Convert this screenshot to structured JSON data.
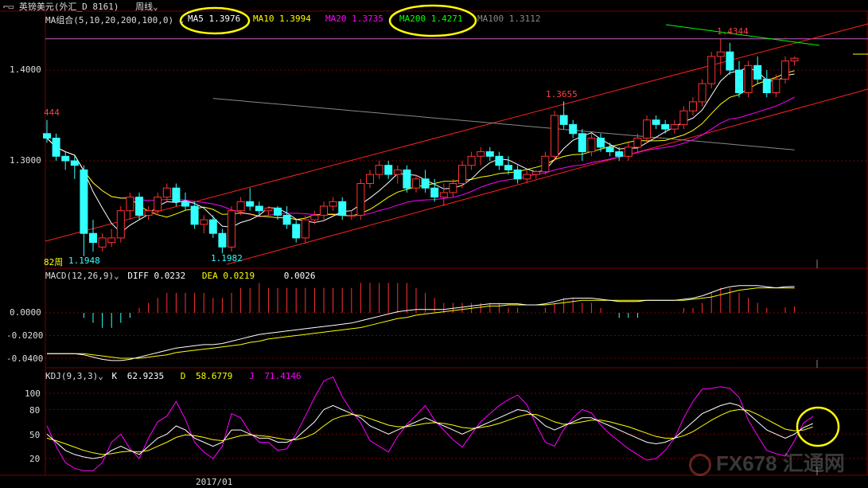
{
  "app": {
    "title_icon": "chart-icon",
    "instrument": "英镑美元(外汇_D 8161)",
    "period": "周线"
  },
  "colors": {
    "bg": "#000000",
    "grid": "#7a0000",
    "up": "#ff3232",
    "down": "#32ffff",
    "ma5": "#ffffff",
    "ma10": "#ffff00",
    "ma20": "#ff00ff",
    "ma100": "#888888",
    "ma200": "#00ff00",
    "channel": "#ff2020",
    "highlight": "#ffff00"
  },
  "main_panel": {
    "indicator_label": "MA组合(5,10,20,200,100,0)",
    "legend": [
      {
        "key": "ma5",
        "label": "MA5",
        "value": "1.3976",
        "color": "#ffffff"
      },
      {
        "key": "ma10",
        "label": "MA10",
        "value": "1.3994",
        "color": "#ffff00"
      },
      {
        "key": "ma20",
        "label": "MA20",
        "value": "1.3735",
        "color": "#ff00ff"
      },
      {
        "key": "ma200",
        "label": "MA200",
        "value": "1.4271",
        "color": "#00ff00"
      },
      {
        "key": "ma100",
        "label": "MA100",
        "value": "1.3112",
        "color": "#888888"
      }
    ],
    "y_ticks": [
      "1.4000",
      "1.3000"
    ],
    "annotations": {
      "high_right": "1.4344",
      "high_mid": "1.3655",
      "low_left": "1.1948",
      "low_mid": "1.1982",
      "left_cut": "444",
      "weeks": "82周"
    }
  },
  "macd_panel": {
    "label": "MACD(12,26,9)",
    "diff_label": "DIFF",
    "diff_value": "0.0232",
    "dea_label": "DEA",
    "dea_value": "0.0219",
    "macd_value": "0.0026",
    "y_ticks": [
      "0.0000",
      "-0.0200",
      "-0.0400"
    ]
  },
  "kdj_panel": {
    "label": "KDJ(9,3,3)",
    "k_label": "K",
    "k_value": "62.9235",
    "d_label": "D",
    "d_value": "58.6779",
    "j_label": "J",
    "j_value": "71.4146",
    "y_ticks": [
      "100",
      "80",
      "50",
      "20"
    ]
  },
  "x_axis": {
    "date_label": "2017/01"
  },
  "watermark": "FX678 汇通网",
  "chart_data": [
    {
      "type": "candlestick",
      "title": "英镑美元(外汇_D 8161) 周线",
      "y_ticks": [
        1.3,
        1.4
      ],
      "ylim": [
        1.17,
        1.445
      ],
      "weeks_shown": 82,
      "annotated_points": {
        "high": 1.4344,
        "mid_high": 1.3655,
        "low": 1.1948,
        "mid_low": 1.1982
      },
      "ohlc": [
        [
          1.33,
          1.345,
          1.32,
          1.325
        ],
        [
          1.325,
          1.33,
          1.3,
          1.305
        ],
        [
          1.305,
          1.31,
          1.29,
          1.3
        ],
        [
          1.3,
          1.305,
          1.28,
          1.295
        ],
        [
          1.29,
          1.295,
          1.195,
          1.22
        ],
        [
          1.22,
          1.235,
          1.2,
          1.21
        ],
        [
          1.205,
          1.22,
          1.2,
          1.215
        ],
        [
          1.21,
          1.225,
          1.205,
          1.215
        ],
        [
          1.215,
          1.25,
          1.21,
          1.245
        ],
        [
          1.245,
          1.265,
          1.235,
          1.26
        ],
        [
          1.26,
          1.265,
          1.235,
          1.24
        ],
        [
          1.24,
          1.25,
          1.235,
          1.245
        ],
        [
          1.245,
          1.265,
          1.24,
          1.26
        ],
        [
          1.26,
          1.275,
          1.255,
          1.27
        ],
        [
          1.27,
          1.275,
          1.25,
          1.255
        ],
        [
          1.255,
          1.265,
          1.245,
          1.25
        ],
        [
          1.25,
          1.255,
          1.225,
          1.23
        ],
        [
          1.23,
          1.24,
          1.22,
          1.235
        ],
        [
          1.235,
          1.24,
          1.215,
          1.22
        ],
        [
          1.22,
          1.225,
          1.198,
          1.205
        ],
        [
          1.205,
          1.25,
          1.2,
          1.245
        ],
        [
          1.245,
          1.26,
          1.24,
          1.255
        ],
        [
          1.255,
          1.27,
          1.245,
          1.25
        ],
        [
          1.25,
          1.255,
          1.24,
          1.245
        ],
        [
          1.245,
          1.25,
          1.24,
          1.248
        ],
        [
          1.248,
          1.25,
          1.235,
          1.24
        ],
        [
          1.24,
          1.25,
          1.225,
          1.23
        ],
        [
          1.23,
          1.235,
          1.21,
          1.215
        ],
        [
          1.215,
          1.24,
          1.21,
          1.235
        ],
        [
          1.235,
          1.245,
          1.23,
          1.24
        ],
        [
          1.24,
          1.255,
          1.235,
          1.25
        ],
        [
          1.25,
          1.26,
          1.245,
          1.255
        ],
        [
          1.255,
          1.26,
          1.235,
          1.24
        ],
        [
          1.24,
          1.245,
          1.235,
          1.24
        ],
        [
          1.24,
          1.28,
          1.235,
          1.275
        ],
        [
          1.275,
          1.29,
          1.27,
          1.285
        ],
        [
          1.285,
          1.3,
          1.28,
          1.295
        ],
        [
          1.295,
          1.3,
          1.28,
          1.285
        ],
        [
          1.285,
          1.295,
          1.275,
          1.29
        ],
        [
          1.29,
          1.295,
          1.265,
          1.27
        ],
        [
          1.27,
          1.285,
          1.265,
          1.28
        ],
        [
          1.28,
          1.29,
          1.265,
          1.27
        ],
        [
          1.27,
          1.28,
          1.255,
          1.26
        ],
        [
          1.26,
          1.275,
          1.25,
          1.265
        ],
        [
          1.265,
          1.28,
          1.26,
          1.275
        ],
        [
          1.275,
          1.3,
          1.27,
          1.295
        ],
        [
          1.295,
          1.31,
          1.29,
          1.305
        ],
        [
          1.305,
          1.315,
          1.295,
          1.31
        ],
        [
          1.31,
          1.315,
          1.3,
          1.305
        ],
        [
          1.305,
          1.31,
          1.29,
          1.295
        ],
        [
          1.295,
          1.305,
          1.285,
          1.29
        ],
        [
          1.29,
          1.295,
          1.275,
          1.28
        ],
        [
          1.28,
          1.29,
          1.275,
          1.285
        ],
        [
          1.285,
          1.29,
          1.28,
          1.288
        ],
        [
          1.288,
          1.31,
          1.285,
          1.305
        ],
        [
          1.305,
          1.355,
          1.3,
          1.35
        ],
        [
          1.35,
          1.3655,
          1.335,
          1.34
        ],
        [
          1.34,
          1.345,
          1.325,
          1.33
        ],
        [
          1.33,
          1.335,
          1.3,
          1.31
        ],
        [
          1.31,
          1.33,
          1.305,
          1.325
        ],
        [
          1.325,
          1.33,
          1.31,
          1.315
        ],
        [
          1.315,
          1.32,
          1.305,
          1.31
        ],
        [
          1.31,
          1.315,
          1.3,
          1.305
        ],
        [
          1.305,
          1.32,
          1.3,
          1.315
        ],
        [
          1.315,
          1.33,
          1.31,
          1.325
        ],
        [
          1.325,
          1.35,
          1.32,
          1.345
        ],
        [
          1.345,
          1.35,
          1.335,
          1.34
        ],
        [
          1.34,
          1.345,
          1.33,
          1.335
        ],
        [
          1.335,
          1.345,
          1.33,
          1.34
        ],
        [
          1.34,
          1.36,
          1.335,
          1.355
        ],
        [
          1.355,
          1.37,
          1.35,
          1.365
        ],
        [
          1.365,
          1.39,
          1.36,
          1.385
        ],
        [
          1.385,
          1.42,
          1.38,
          1.415
        ],
        [
          1.415,
          1.4344,
          1.395,
          1.42
        ],
        [
          1.42,
          1.43,
          1.395,
          1.4
        ],
        [
          1.4,
          1.41,
          1.37,
          1.375
        ],
        [
          1.375,
          1.41,
          1.37,
          1.405
        ],
        [
          1.405,
          1.415,
          1.385,
          1.39
        ],
        [
          1.39,
          1.4,
          1.37,
          1.375
        ],
        [
          1.375,
          1.395,
          1.37,
          1.39
        ],
        [
          1.39,
          1.415,
          1.385,
          1.41
        ],
        [
          1.41,
          1.415,
          1.405,
          1.413
        ]
      ],
      "ma_last": {
        "MA5": 1.3976,
        "MA10": 1.3994,
        "MA20": 1.3735,
        "MA200": 1.4271,
        "MA100": 1.3112
      }
    },
    {
      "type": "bar+line",
      "title": "MACD(12,26,9)",
      "y_ticks": [
        0.0,
        -0.02,
        -0.04
      ],
      "ylim": [
        -0.048,
        0.012
      ],
      "diff_last": 0.0232,
      "dea_last": 0.0219,
      "macd_last": 0.0026,
      "diff": [
        -0.036,
        -0.036,
        -0.036,
        -0.036,
        -0.037,
        -0.039,
        -0.041,
        -0.042,
        -0.042,
        -0.041,
        -0.039,
        -0.037,
        -0.035,
        -0.033,
        -0.031,
        -0.03,
        -0.029,
        -0.028,
        -0.028,
        -0.027,
        -0.025,
        -0.023,
        -0.021,
        -0.019,
        -0.018,
        -0.017,
        -0.016,
        -0.015,
        -0.014,
        -0.013,
        -0.012,
        -0.011,
        -0.01,
        -0.009,
        -0.007,
        -0.005,
        -0.003,
        -0.001,
        0.001,
        0.002,
        0.003,
        0.003,
        0.003,
        0.003,
        0.004,
        0.005,
        0.006,
        0.007,
        0.008,
        0.008,
        0.008,
        0.008,
        0.007,
        0.007,
        0.008,
        0.01,
        0.012,
        0.013,
        0.013,
        0.013,
        0.012,
        0.011,
        0.01,
        0.01,
        0.01,
        0.011,
        0.011,
        0.011,
        0.011,
        0.012,
        0.013,
        0.015,
        0.018,
        0.021,
        0.023,
        0.024,
        0.024,
        0.024,
        0.023,
        0.022,
        0.023,
        0.0232
      ],
      "dea": [
        -0.036,
        -0.036,
        -0.036,
        -0.036,
        -0.036,
        -0.037,
        -0.038,
        -0.039,
        -0.04,
        -0.04,
        -0.04,
        -0.039,
        -0.038,
        -0.037,
        -0.035,
        -0.034,
        -0.033,
        -0.032,
        -0.031,
        -0.03,
        -0.029,
        -0.028,
        -0.026,
        -0.025,
        -0.023,
        -0.022,
        -0.021,
        -0.02,
        -0.019,
        -0.018,
        -0.017,
        -0.016,
        -0.015,
        -0.014,
        -0.013,
        -0.011,
        -0.009,
        -0.007,
        -0.005,
        -0.004,
        -0.002,
        -0.001,
        0.0,
        0.001,
        0.002,
        0.003,
        0.004,
        0.005,
        0.006,
        0.006,
        0.007,
        0.007,
        0.007,
        0.007,
        0.007,
        0.008,
        0.009,
        0.01,
        0.011,
        0.011,
        0.011,
        0.011,
        0.011,
        0.011,
        0.011,
        0.011,
        0.011,
        0.011,
        0.011,
        0.011,
        0.012,
        0.013,
        0.014,
        0.016,
        0.018,
        0.02,
        0.021,
        0.022,
        0.022,
        0.022,
        0.0219,
        0.0219
      ]
    },
    {
      "type": "line",
      "title": "KDJ(9,3,3)",
      "y_ticks": [
        20,
        50,
        80,
        100
      ],
      "ylim": [
        0,
        115
      ],
      "k_last": 62.9235,
      "d_last": 58.6779,
      "j_last": 71.4146,
      "k": [
        50,
        40,
        30,
        25,
        22,
        20,
        22,
        30,
        35,
        30,
        25,
        35,
        45,
        50,
        60,
        55,
        45,
        40,
        35,
        40,
        55,
        55,
        50,
        45,
        45,
        40,
        40,
        45,
        55,
        65,
        80,
        85,
        80,
        75,
        70,
        60,
        55,
        50,
        55,
        60,
        65,
        70,
        65,
        60,
        55,
        50,
        55,
        60,
        65,
        70,
        75,
        80,
        78,
        70,
        60,
        55,
        60,
        65,
        70,
        70,
        65,
        60,
        55,
        50,
        45,
        40,
        38,
        40,
        45,
        55,
        65,
        75,
        80,
        85,
        88,
        85,
        75,
        65,
        55,
        50,
        45,
        50,
        58,
        62.9
      ],
      "d": [
        45,
        42,
        38,
        34,
        30,
        27,
        25,
        26,
        28,
        29,
        28,
        30,
        35,
        40,
        46,
        49,
        48,
        46,
        43,
        42,
        45,
        48,
        49,
        48,
        47,
        45,
        43,
        43,
        46,
        51,
        60,
        68,
        72,
        74,
        73,
        69,
        65,
        61,
        59,
        59,
        61,
        63,
        64,
        63,
        61,
        58,
        57,
        58,
        60,
        63,
        67,
        71,
        74,
        74,
        70,
        65,
        62,
        63,
        65,
        67,
        67,
        65,
        62,
        59,
        55,
        51,
        47,
        45,
        45,
        48,
        53,
        60,
        67,
        73,
        78,
        80,
        79,
        74,
        68,
        62,
        56,
        54,
        55,
        58.7
      ],
      "j": [
        60,
        35,
        15,
        8,
        5,
        5,
        15,
        40,
        50,
        32,
        20,
        45,
        65,
        72,
        90,
        68,
        40,
        28,
        20,
        35,
        75,
        70,
        52,
        40,
        40,
        30,
        32,
        50,
        72,
        95,
        115,
        120,
        96,
        78,
        64,
        42,
        35,
        28,
        47,
        62,
        73,
        85,
        67,
        55,
        43,
        34,
        50,
        65,
        75,
        85,
        92,
        98,
        86,
        62,
        40,
        35,
        56,
        70,
        80,
        76,
        61,
        50,
        41,
        32,
        25,
        18,
        20,
        30,
        45,
        70,
        90,
        105,
        106,
        108,
        106,
        95,
        67,
        48,
        30,
        26,
        23,
        42,
        64,
        71.4
      ]
    }
  ]
}
